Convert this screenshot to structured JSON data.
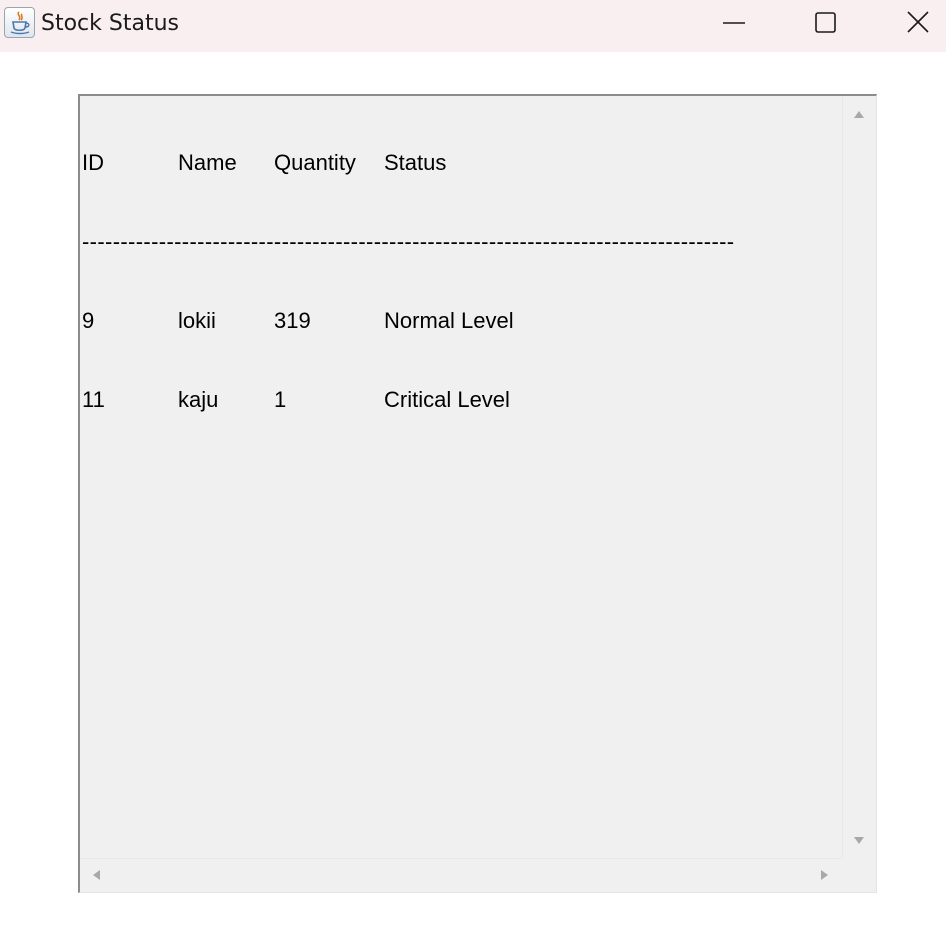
{
  "window": {
    "title": "Stock Status",
    "icon": "java-cup-icon",
    "titlebar_color": "#f9eff1"
  },
  "controls": {
    "minimize_icon": "minimize-icon",
    "maximize_icon": "maximize-icon",
    "close_icon": "close-icon"
  },
  "report": {
    "headers": {
      "id": "ID",
      "name": "Name",
      "quantity": "Quantity",
      "status": "Status"
    },
    "separator": "-------------------------------------------------------------------------------------",
    "rows": [
      {
        "id": "9",
        "name": "lokii",
        "quantity": "319",
        "status": "Normal Level"
      },
      {
        "id": "11",
        "name": "kaju",
        "quantity": "1",
        "status": "Critical Level"
      }
    ],
    "background": "#f0f0f0"
  },
  "scrollbars": {
    "vertical": {
      "up_icon": "scroll-up-arrow-icon",
      "down_icon": "scroll-down-arrow-icon"
    },
    "horizontal": {
      "left_icon": "scroll-left-arrow-icon",
      "right_icon": "scroll-right-arrow-icon"
    }
  }
}
